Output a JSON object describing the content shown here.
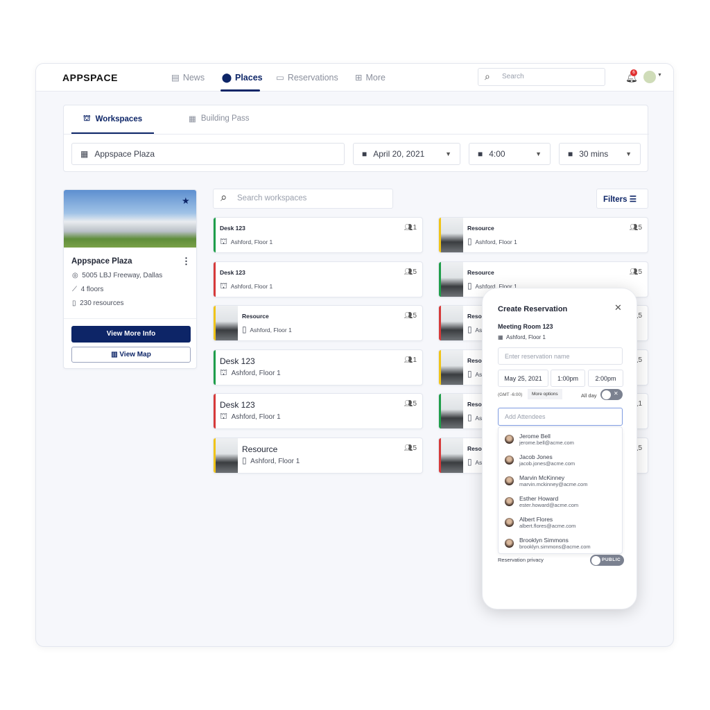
{
  "header": {
    "logo": "APPSPACE",
    "nav": [
      {
        "label": "News",
        "icon": "news-icon"
      },
      {
        "label": "Places",
        "icon": "location-icon",
        "active": true
      },
      {
        "label": "Reservations",
        "icon": "calendar-icon"
      },
      {
        "label": "More",
        "icon": "grid-icon"
      }
    ],
    "search_placeholder": "Search",
    "notifications": "6"
  },
  "tabs": [
    {
      "label": "Workspaces",
      "active": true
    },
    {
      "label": "Building Pass"
    }
  ],
  "filters": {
    "building": "Appspace Plaza",
    "date": "April 20, 2021",
    "time": "4:00",
    "duration": "30 mins"
  },
  "building": {
    "name": "Appspace Plaza",
    "address": "5005 LBJ Freeway, Dallas",
    "floors": "4 floors",
    "resources": "230 resources",
    "view_more": "View More Info",
    "view_map": "View Map"
  },
  "search_workspaces_placeholder": "Search workspaces",
  "filters_label": "Filters",
  "colors": {
    "green": "#1f9e4a",
    "red": "#d63a3a",
    "yellow": "#f0c419",
    "primary": "#0d2567"
  },
  "workspaces_left": [
    {
      "name": "Desk 123",
      "location": "Ashford, Floor 1",
      "capacity": "1",
      "status": "green",
      "type": "desk"
    },
    {
      "name": "Desk 123",
      "location": "Ashford, Floor 1",
      "capacity": "5",
      "status": "red",
      "type": "desk"
    },
    {
      "name": "Resource",
      "location": "Ashford, Floor 1",
      "capacity": "5",
      "status": "yellow",
      "type": "resource"
    },
    {
      "name": "Desk 123",
      "location": "Ashford, Floor 1",
      "capacity": "1",
      "status": "green",
      "type": "desk",
      "big": true
    },
    {
      "name": "Desk 123",
      "location": "Ashford, Floor 1",
      "capacity": "5",
      "status": "red",
      "type": "desk",
      "big": true
    },
    {
      "name": "Resource",
      "location": "Ashford, Floor 1",
      "capacity": "5",
      "status": "yellow",
      "type": "resource",
      "big": true
    }
  ],
  "workspaces_right": [
    {
      "name": "Resource",
      "location": "Ashford, Floor 1",
      "capacity": "5",
      "status": "yellow",
      "type": "resource"
    },
    {
      "name": "Resource",
      "location": "Ashford, Floor 1",
      "capacity": "5",
      "status": "green",
      "type": "resource"
    },
    {
      "name": "Resource",
      "location": "Ashford, Floor 1",
      "capacity": "5",
      "status": "red",
      "type": "resource"
    },
    {
      "name": "Resource",
      "location": "Ashford, Floor 1",
      "capacity": "5",
      "status": "yellow",
      "type": "resource"
    },
    {
      "name": "Resource",
      "location": "Ashford, Floor 1",
      "capacity": "1",
      "status": "green",
      "type": "resource"
    },
    {
      "name": "Resource",
      "location": "Ashford, Floor 1",
      "capacity": "5",
      "status": "red",
      "type": "resource"
    }
  ],
  "modal": {
    "title": "Create Reservation",
    "room": "Meeting Room 123",
    "location": "Ashford, Floor 1",
    "name_placeholder": "Enter reservation name",
    "date": "May 25, 2021",
    "start": "1:00pm",
    "end": "2:00pm",
    "timezone": "(GMT -6:00)",
    "more_options": "More options",
    "all_day": "All day",
    "attendees_placeholder": "Add Attendees",
    "privacy_label": "Reservation privacy",
    "privacy_value": "PUBLIC",
    "attendees": [
      {
        "name": "Jerome Bell",
        "email": "jerome.bell@acme.com"
      },
      {
        "name": "Jacob Jones",
        "email": "jacob.jones@acme.com"
      },
      {
        "name": "Marvin McKinney",
        "email": "marvin.mckinney@acme.com"
      },
      {
        "name": "Esther Howard",
        "email": "ester.howard@acme.com"
      },
      {
        "name": "Albert Flores",
        "email": "albert.flores@acme.com"
      },
      {
        "name": "Brooklyn Simmons",
        "email": "brooklyn.simmons@acme.com"
      }
    ]
  }
}
